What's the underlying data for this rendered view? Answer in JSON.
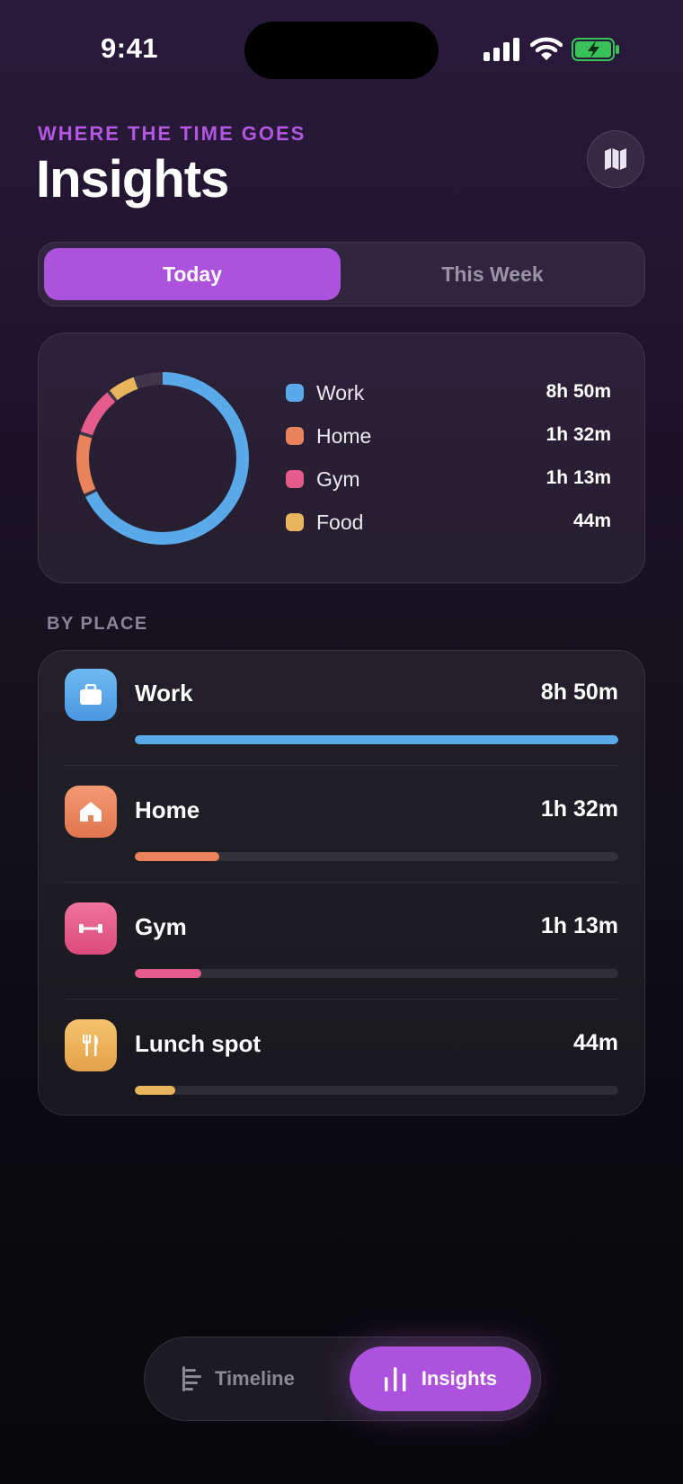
{
  "status_bar": {
    "time": "9:41"
  },
  "header": {
    "eyebrow": "WHERE THE TIME GOES",
    "title": "Insights",
    "map_icon": "map-icon"
  },
  "segmented": {
    "options": [
      "Today",
      "This Week"
    ],
    "selected": "Today"
  },
  "summary": {
    "legend": [
      {
        "label": "Work",
        "value": "8h 50m",
        "minutes": 530,
        "color": "#5aaaea"
      },
      {
        "label": "Home",
        "value": "1h 32m",
        "minutes": 92,
        "color": "#ea835c"
      },
      {
        "label": "Gym",
        "value": "1h 13m",
        "minutes": 73,
        "color": "#e55c8c"
      },
      {
        "label": "Food",
        "value": "44m",
        "minutes": 44,
        "color": "#e8b55c"
      }
    ]
  },
  "by_place": {
    "label": "BY PLACE",
    "items": [
      {
        "name": "Work",
        "value": "8h 50m",
        "icon": "briefcase-icon",
        "fraction": 1.0,
        "color": "#5aaaea"
      },
      {
        "name": "Home",
        "value": "1h 32m",
        "icon": "house-icon",
        "fraction": 0.174,
        "color": "#ea835c"
      },
      {
        "name": "Gym",
        "value": "1h 13m",
        "icon": "dumbbell-icon",
        "fraction": 0.138,
        "color": "#e55c8c"
      },
      {
        "name": "Lunch spot",
        "value": "44m",
        "icon": "fork-knife-icon",
        "fraction": 0.083,
        "color": "#e8b55c"
      }
    ]
  },
  "tabbar": {
    "tabs": [
      {
        "label": "Timeline",
        "icon": "timeline-icon",
        "active": false
      },
      {
        "label": "Insights",
        "icon": "bar-chart-icon",
        "active": true
      }
    ]
  }
}
